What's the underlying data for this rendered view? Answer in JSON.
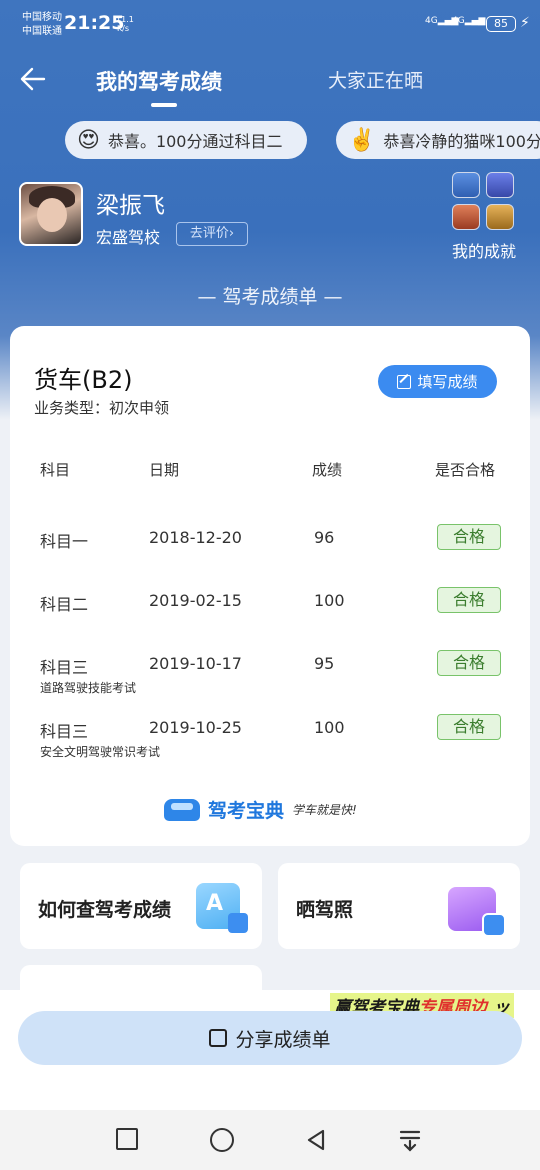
{
  "status_bar": {
    "carrier1": "中国移动",
    "carrier2": "中国联通",
    "time": "21:25",
    "net_speed_top": "11.1",
    "net_speed_bottom": "K/s",
    "signal1": "4G",
    "signal2": "4G",
    "battery": "85"
  },
  "header": {
    "tab_active": "我的驾考成绩",
    "tab_inactive": "大家正在晒"
  },
  "ticker": [
    {
      "icon": "star-eyes-emoji",
      "text": "恭喜。100分通过科目二"
    },
    {
      "icon": "victory-hand-emoji",
      "text": "恭喜冷静的猫咪100分"
    }
  ],
  "profile": {
    "name": "梁振飞",
    "school": "宏盛驾校",
    "rate_label": "去评价",
    "achievements_label": "我的成就"
  },
  "section_title": "— 驾考成绩单 —",
  "card": {
    "vehicle": "货车(B2)",
    "business_type": "业务类型：初次申领",
    "fill_button": "填写成绩",
    "headers": [
      "科目",
      "日期",
      "成绩",
      "是否合格"
    ],
    "rows": [
      {
        "subject": "科目一",
        "date": "2018-12-20",
        "score": "96",
        "result": "合格",
        "note": ""
      },
      {
        "subject": "科目二",
        "date": "2019-02-15",
        "score": "100",
        "result": "合格",
        "note": ""
      },
      {
        "subject": "科目三",
        "date": "2019-10-17",
        "score": "95",
        "result": "合格",
        "note": "道路驾驶技能考试"
      },
      {
        "subject": "科目三",
        "date": "2019-10-25",
        "score": "100",
        "result": "合格",
        "note": "安全文明驾驶常识考试"
      }
    ],
    "brand": "驾考宝典",
    "slogan": "学车就是快!"
  },
  "mini_cards": {
    "query": "如何查驾考成绩",
    "license": "晒驾照"
  },
  "promo": {
    "part1": "赢驾考宝典",
    "part2": "专属周边"
  },
  "share_button": "分享成绩单",
  "colors": {
    "header_blue": "#3f75bf",
    "accent_blue": "#3b8bf0",
    "pass_green": "#79c36a"
  }
}
